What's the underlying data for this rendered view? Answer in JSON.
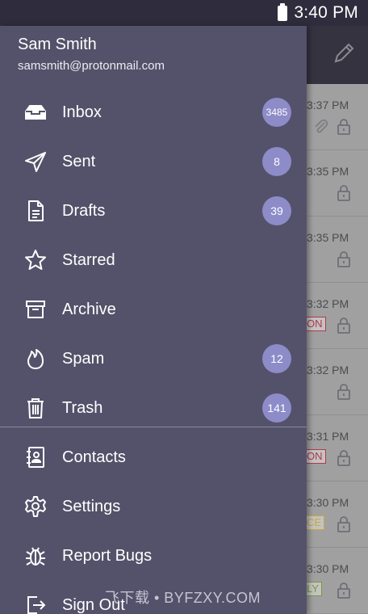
{
  "status_bar": {
    "time": "3:40 PM"
  },
  "account": {
    "name": "Sam Smith",
    "email": "samsmith@protonmail.com"
  },
  "nav": {
    "inbox": {
      "label": "Inbox",
      "count": "3485"
    },
    "sent": {
      "label": "Sent",
      "count": "8"
    },
    "drafts": {
      "label": "Drafts",
      "count": "39"
    },
    "starred": {
      "label": "Starred"
    },
    "archive": {
      "label": "Archive"
    },
    "spam": {
      "label": "Spam",
      "count": "12"
    },
    "trash": {
      "label": "Trash",
      "count": "141"
    },
    "contacts": {
      "label": "Contacts"
    },
    "settings": {
      "label": "Settings"
    },
    "report_bugs": {
      "label": "Report Bugs"
    },
    "sign_out": {
      "label": "Sign Out"
    }
  },
  "background_list": {
    "times": [
      "3:37 PM",
      "3:35 PM",
      "3:35 PM",
      "3:32 PM",
      "3:32 PM",
      "3:31 PM",
      "3:30 PM",
      "3:30 PM"
    ],
    "tags": [
      "ON",
      "ON",
      "CE",
      "LY"
    ]
  },
  "watermark": "飞下载 • BYFZXY.COM",
  "icons": {
    "inbox": "inbox-icon",
    "sent": "send-icon",
    "drafts": "draft-icon",
    "starred": "star-icon",
    "archive": "archive-icon",
    "spam": "flame-icon",
    "trash": "trash-icon",
    "contacts": "contacts-icon",
    "settings": "gear-icon",
    "report_bugs": "bug-icon",
    "sign_out": "sign-out-icon",
    "compose": "pencil-icon"
  },
  "colors": {
    "drawer": "#54526a",
    "badge": "#8d8bc8",
    "status_bar": "#2f2d3d"
  }
}
